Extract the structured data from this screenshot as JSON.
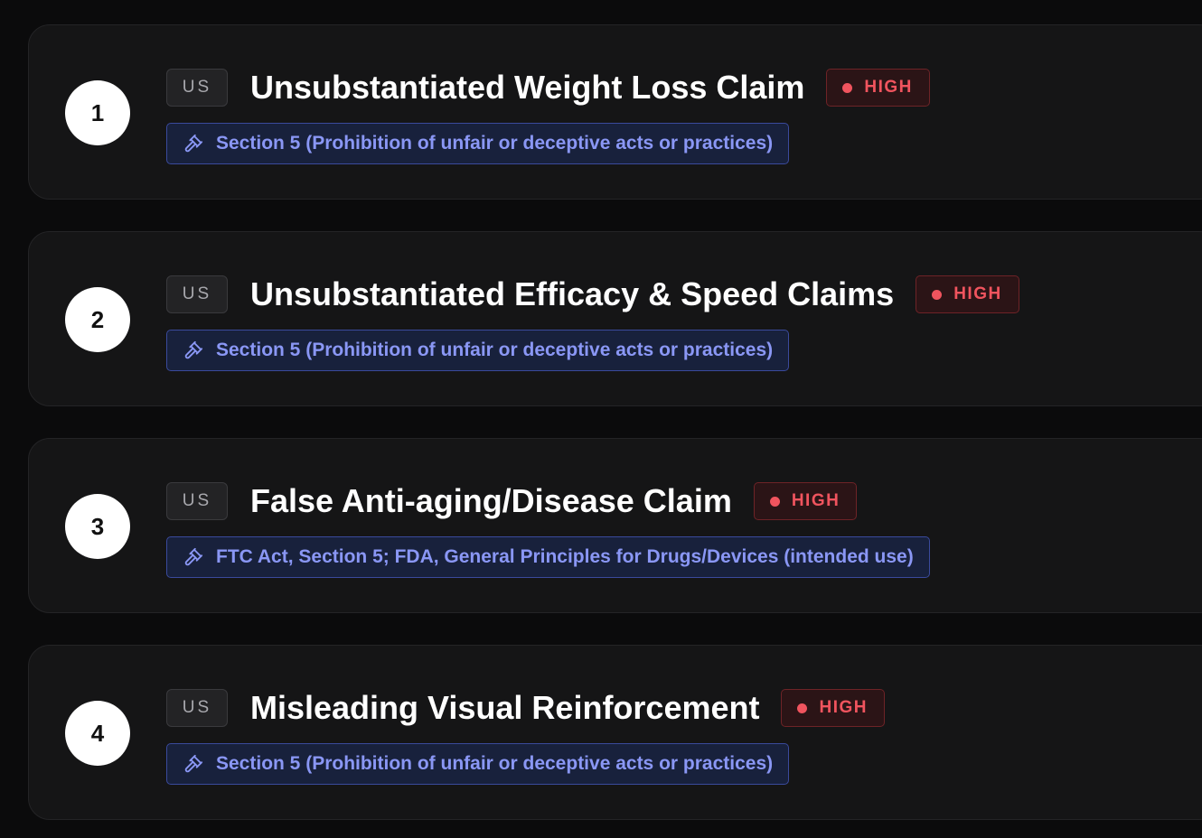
{
  "items": [
    {
      "number": "1",
      "region": "US",
      "title": "Unsubstantiated Weight Loss Claim",
      "severity": "HIGH",
      "regulation": "Section 5 (Prohibition of unfair or deceptive acts or practices)"
    },
    {
      "number": "2",
      "region": "US",
      "title": "Unsubstantiated Efficacy & Speed Claims",
      "severity": "HIGH",
      "regulation": "Section 5 (Prohibition of unfair or deceptive acts or practices)"
    },
    {
      "number": "3",
      "region": "US",
      "title": "False Anti-aging/Disease Claim",
      "severity": "HIGH",
      "regulation": "FTC Act, Section 5; FDA, General Principles for Drugs/Devices (intended use)"
    },
    {
      "number": "4",
      "region": "US",
      "title": "Misleading Visual Reinforcement",
      "severity": "HIGH",
      "regulation": "Section 5 (Prohibition of unfair or deceptive acts or practices)"
    }
  ],
  "icons": {
    "severity": "dot-icon",
    "regulation": "gavel-icon"
  },
  "colors": {
    "severity_high": "#f0545e",
    "regulation_text": "#8a97f5",
    "card_background": "#151516"
  }
}
